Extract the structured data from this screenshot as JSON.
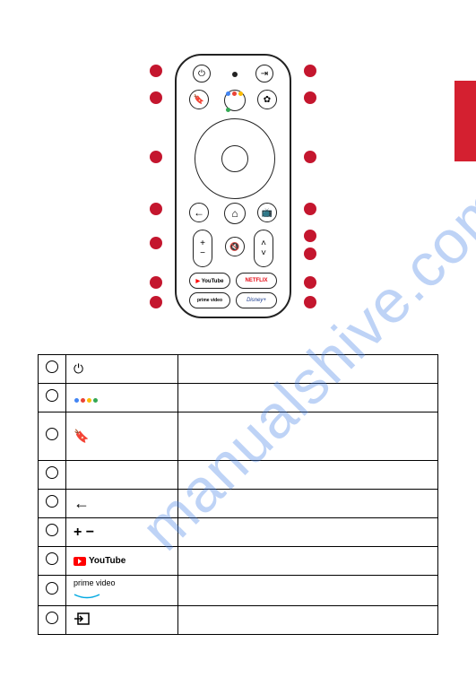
{
  "watermark": "manualshive.com",
  "remote": {
    "buttons": {
      "power": "⏻",
      "input": "⇥",
      "bookmark": "🔖",
      "assistant": "assistant",
      "settings": "⚙",
      "back": "←",
      "home": "⌂",
      "guide": "📺",
      "vol_plus": "+",
      "vol_minus": "−",
      "mute": "🔇",
      "ch_up": "˄",
      "ch_down": "˅",
      "youtube": "YouTube",
      "netflix": "NETFLIX",
      "primevideo": "prime video",
      "disney": "Disney+"
    }
  },
  "table": {
    "rows": [
      {
        "icon": "power",
        "label": "⏻",
        "desc": ""
      },
      {
        "icon": "assistant",
        "label": "",
        "desc": ""
      },
      {
        "icon": "bookmark",
        "label": "🔖",
        "desc": "",
        "tall": true
      },
      {
        "icon": "blank",
        "label": "",
        "desc": ""
      },
      {
        "icon": "back",
        "label": "←",
        "desc": ""
      },
      {
        "icon": "volume",
        "label": "+  −",
        "desc": ""
      },
      {
        "icon": "youtube",
        "label": "YouTube",
        "desc": ""
      },
      {
        "icon": "primevideo",
        "label": "prime video",
        "desc": ""
      },
      {
        "icon": "input",
        "label": "⇥",
        "desc": ""
      }
    ]
  }
}
